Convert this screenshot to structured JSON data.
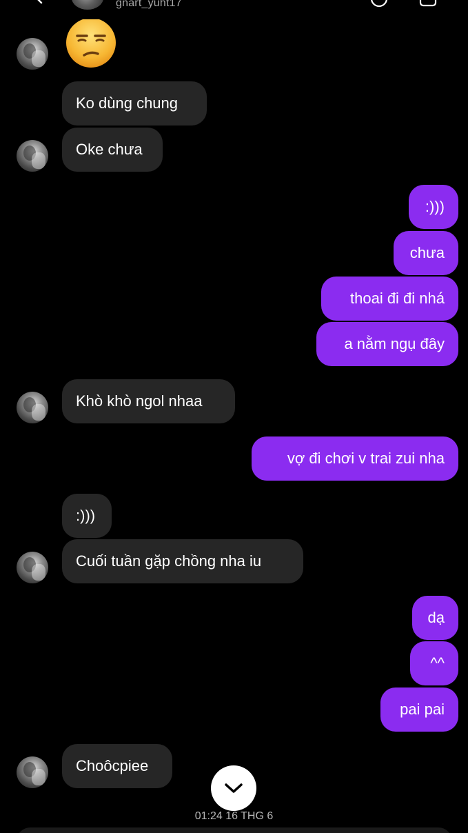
{
  "header": {
    "username": "gnart_yuht17"
  },
  "messages": [
    {
      "side": "in",
      "text": "Ko dùng chung"
    },
    {
      "side": "in",
      "text": "Oke chưa"
    },
    {
      "side": "out",
      "text": ":)))"
    },
    {
      "side": "out",
      "text": "chưa"
    },
    {
      "side": "out",
      "text": "thoai đi đi nhá"
    },
    {
      "side": "out",
      "text": "a nằm ngụ đây"
    },
    {
      "side": "in",
      "text": "Khò khò ngol nhaa"
    },
    {
      "side": "out",
      "text": "vợ đi chơi v trai zui nha"
    },
    {
      "side": "in",
      "text": ":)))"
    },
    {
      "side": "in",
      "text": "Cuối tuần gặp chồng nha iu"
    },
    {
      "side": "out",
      "text": "dạ"
    },
    {
      "side": "out",
      "text": "^^"
    },
    {
      "side": "out",
      "text": "pai pai"
    },
    {
      "side": "in",
      "text": "Choôcpiee"
    }
  ],
  "timestamp": "01:24 16 THG 6",
  "colors": {
    "background": "#000000",
    "incoming_bubble": "#262626",
    "outgoing_bubble": "#8b2cf0"
  },
  "icons": {
    "emoji": "unamused-face-icon",
    "scroll": "chevron-down-icon",
    "back": "back-arrow-icon",
    "call": "phone-icon",
    "video": "video-icon"
  }
}
